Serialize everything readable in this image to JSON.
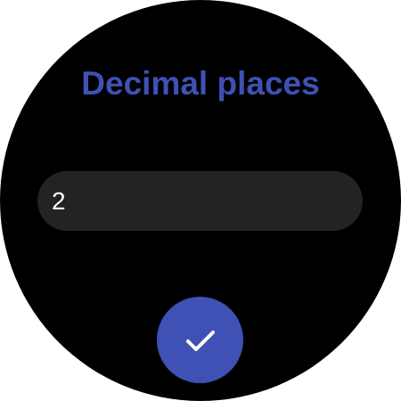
{
  "screen": {
    "title": "Decimal places"
  },
  "input": {
    "value": "2"
  },
  "confirm": {
    "icon": "check-icon"
  },
  "colors": {
    "accent": "#3f51b5",
    "background": "#000000",
    "field": "#232323",
    "text": "#ffffff"
  }
}
